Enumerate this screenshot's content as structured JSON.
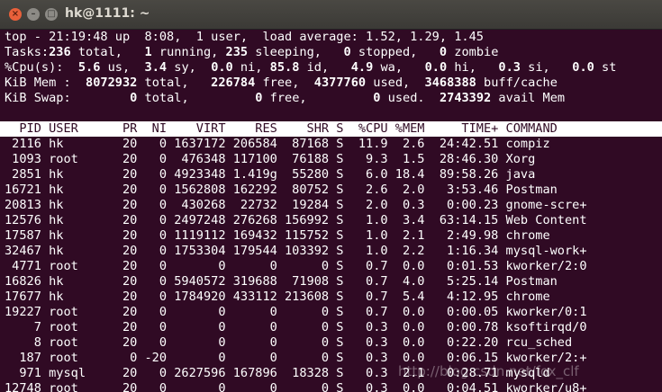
{
  "window": {
    "title": "hk@1111: ~",
    "close_glyph": "×",
    "min_glyph": "–",
    "max_glyph": "□"
  },
  "top": {
    "line1": "top - 21:19:48 up  8:08,  1 user,  load average: 1.52, 1.29, 1.45",
    "tasks": [
      "Tasks:",
      "236",
      " total,   ",
      "1",
      " running, ",
      "235",
      " sleeping,   ",
      "0",
      " stopped,   ",
      "0",
      " zombie"
    ],
    "cpu": [
      "%Cpu(s):",
      "  5.6",
      " us, ",
      " 3.4",
      " sy,  ",
      "0.0",
      " ni, ",
      "85.8",
      " id,  ",
      " 4.9",
      " wa,  ",
      " 0.0",
      " hi,  ",
      " 0.3",
      " si,  ",
      " 0.0",
      " st"
    ],
    "mem": [
      "KiB Mem : ",
      " 8072932",
      " total, ",
      "  226784",
      " free, ",
      " 4377760",
      " used, ",
      " 3468388",
      " buff/cache"
    ],
    "swap": [
      "KiB Swap:",
      "        0",
      " total, ",
      "        0",
      " free, ",
      "        0",
      " used. ",
      " 2743392",
      " avail Mem"
    ]
  },
  "header": "  PID USER      PR  NI    VIRT    RES    SHR S  %CPU %MEM     TIME+ COMMAND",
  "processes": [
    " 2116 hk        20   0 1637172 206584  87168 S  11.9  2.6  24:42.51 compiz",
    " 1093 root      20   0  476348 117100  76188 S   9.3  1.5  28:46.30 Xorg",
    " 2851 hk        20   0 4923348 1.419g  55280 S   6.0 18.4  89:58.26 java",
    "16721 hk        20   0 1562808 162292  80752 S   2.6  2.0   3:53.46 Postman",
    "20813 hk        20   0  430268  22732  19284 S   2.0  0.3   0:00.23 gnome-scre+",
    "12576 hk        20   0 2497248 276268 156992 S   1.0  3.4  63:14.15 Web Content",
    "17587 hk        20   0 1119112 169432 115752 S   1.0  2.1   2:49.98 chrome",
    "32467 hk        20   0 1753304 179544 103392 S   1.0  2.2   1:16.34 mysql-work+",
    " 4771 root      20   0       0      0      0 S   0.7  0.0   0:01.53 kworker/2:0",
    "16826 hk        20   0 5940572 319688  71908 S   0.7  4.0   5:25.14 Postman",
    "17677 hk        20   0 1784920 433112 213608 S   0.7  5.4   4:12.95 chrome",
    "19227 root      20   0       0      0      0 S   0.7  0.0   0:00.05 kworker/0:1",
    "    7 root      20   0       0      0      0 S   0.3  0.0   0:00.78 ksoftirqd/0",
    "    8 root      20   0       0      0      0 S   0.3  0.0   0:22.20 rcu_sched",
    "  187 root       0 -20       0      0      0 S   0.3  0.0   0:06.15 kworker/2:+",
    "  971 mysql     20   0 2627596 167896  18328 S   0.3  2.1   0:28.71 mysqld",
    "12748 root      20   0       0      0      0 S   0.3  0.0   0:04.51 kworker/u8+"
  ],
  "watermark": "http://blog.csdn.net/fox_clf"
}
